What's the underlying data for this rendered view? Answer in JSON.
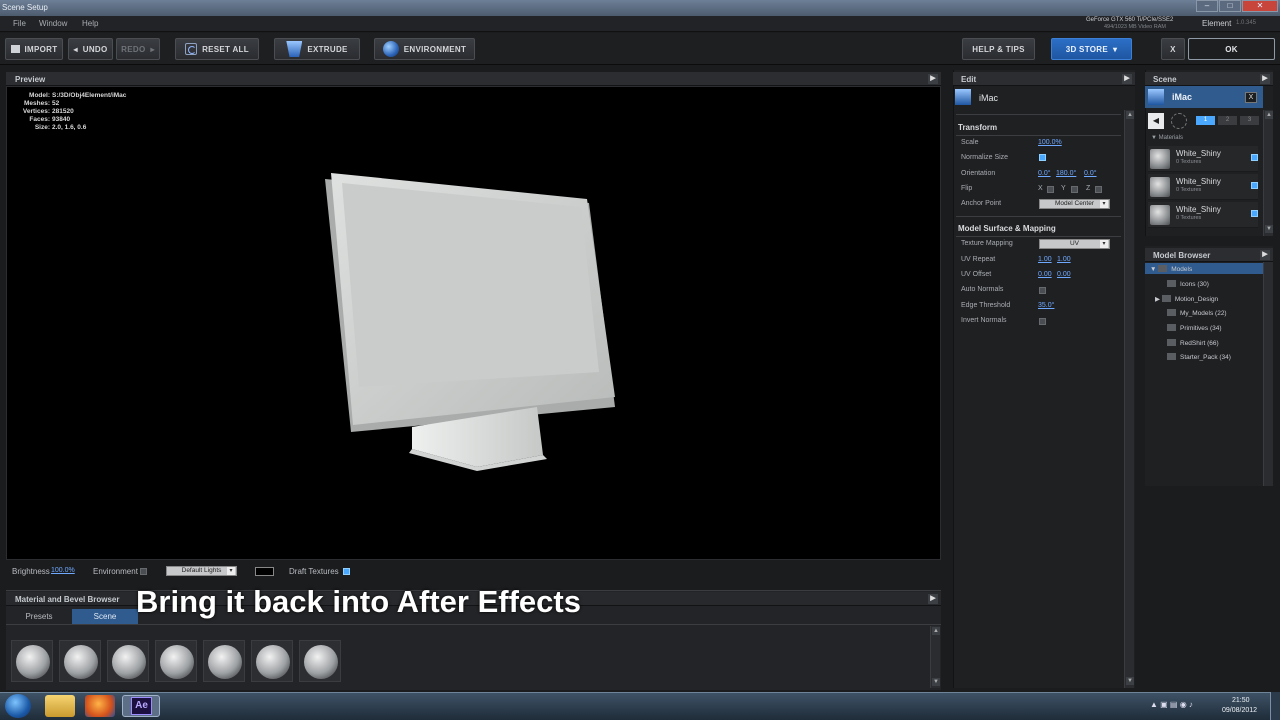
{
  "window": {
    "title": "Scene Setup",
    "gpu_line1": "GeForce GTX 560 Ti/PCIe/SSE2",
    "gpu_line2": "494/1023 MB Video RAM",
    "app_name": "Element",
    "version": "1.0.345"
  },
  "menu": [
    "File",
    "Window",
    "Help"
  ],
  "toolbar": {
    "import": "IMPORT",
    "undo": "UNDO",
    "redo": "REDO",
    "reset_all": "RESET ALL",
    "extrude": "EXTRUDE",
    "environment": "ENVIRONMENT",
    "help_tips": "HELP & TIPS",
    "store": "3D STORE",
    "cancel": "X",
    "ok": "OK"
  },
  "preview": {
    "title": "Preview",
    "stats": [
      {
        "k": "Model:",
        "v": "S:/3D/Obj4Element/iMac"
      },
      {
        "k": "Meshes:",
        "v": "52"
      },
      {
        "k": "Vertices:",
        "v": "281520"
      },
      {
        "k": "Faces:",
        "v": "93840"
      },
      {
        "k": "Size:",
        "v": "2.0, 1.6, 0.6"
      }
    ]
  },
  "bottom": {
    "brightness_label": "Brightness",
    "brightness_value": "100.0%",
    "environment_label": "Environment",
    "lights": "Default Lights",
    "draft_label": "Draft Textures"
  },
  "material_browser": {
    "title": "Material and Bevel Browser",
    "tabs": [
      "Presets",
      "Scene"
    ],
    "active_tab": "Scene",
    "sphere_count": 7
  },
  "subtitle": "Bring it back into After Effects",
  "edit": {
    "title": "Edit",
    "object": "iMac",
    "transform": "Transform",
    "scale_label": "Scale",
    "scale": "100.0%",
    "normalize_label": "Normalize Size",
    "orientation_label": "Orientation",
    "orientation": [
      "0.0°",
      "180.0°",
      "0.0°"
    ],
    "flip_label": "Flip",
    "flip_axes": [
      "X",
      "Y",
      "Z"
    ],
    "anchor_label": "Anchor Point",
    "anchor": "Model Center",
    "surface": "Model Surface & Mapping",
    "texmap_label": "Texture Mapping",
    "texmap": "UV",
    "uvrepeat_label": "UV Repeat",
    "uvrepeat": [
      "1.00",
      "1.00"
    ],
    "uvoffset_label": "UV Offset",
    "uvoffset": [
      "0.00",
      "0.00"
    ],
    "autonormals_label": "Auto Normals",
    "edge_label": "Edge Threshold",
    "edge": "35.0°",
    "invert_label": "Invert Normals"
  },
  "scene": {
    "title": "Scene",
    "object": "iMac",
    "close": "X",
    "materials_label": "Materials",
    "group_tabs": [
      "1",
      "2",
      "3"
    ],
    "materials": [
      {
        "name": "White_Shiny",
        "sub": "0 Textures"
      },
      {
        "name": "White_Shiny",
        "sub": "0 Textures"
      },
      {
        "name": "White_Shiny",
        "sub": "0 Textures"
      }
    ]
  },
  "model_browser": {
    "title": "Model Browser",
    "root": "Models",
    "items": [
      "Icons (30)",
      "Motion_Design",
      "My_Models (22)",
      "Primitives (34)",
      "RedShirt (66)",
      "Starter_Pack (34)"
    ]
  },
  "taskbar": {
    "time": "21:50",
    "date": "09/08/2012"
  },
  "colors": {
    "accent": "#4aa8ff",
    "store": "#2c6fc6"
  }
}
